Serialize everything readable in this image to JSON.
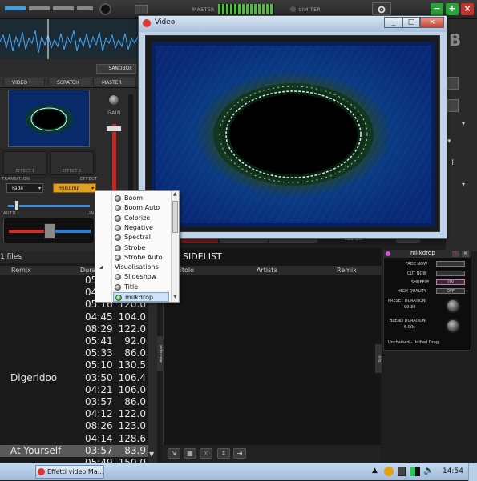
{
  "colors": {
    "accent_red": "#d62b2b",
    "accent_blue": "#2a7fd4",
    "preset_green": "#3cff40",
    "menu_select": "#cde4fb",
    "milkdrop_bg": "#0d0d0d"
  },
  "topbar": {
    "master_label": "MASTER",
    "limiter_label": "LIMITER",
    "gear_icon": "gear-icon",
    "minimize_label": "−",
    "maximize_label": "+",
    "close_label": "×"
  },
  "sandbox_label": "SANDBOX",
  "deck_tabs": {
    "video": "VIDEO",
    "scratch": "SCRATCH",
    "master": "MASTER"
  },
  "gain_label": "GAIN",
  "fx_slots": [
    "EFFECT 1",
    "EFFECT 2"
  ],
  "transition": {
    "label": "TRANSITION",
    "value": "Fade"
  },
  "effect": {
    "label": "EFFECT",
    "value": "milkdrop"
  },
  "crossfade": {
    "left": "AUTO",
    "right": "LIN"
  },
  "menu": {
    "items": [
      "Boom",
      "Boom Auto",
      "Colorize",
      "Negative",
      "Spectral",
      "Strobe",
      "Strobe Auto"
    ],
    "visualisations_header": "Visualisations",
    "vis_items": [
      "Slideshow",
      "Title",
      "milkdrop"
    ]
  },
  "video_window": {
    "title": "Video",
    "letter_behind": "B",
    "custom_label": "CUSTOM"
  },
  "browser": {
    "files_label": "1 files",
    "columns": {
      "remix": "Remix",
      "duration": "Dura"
    },
    "rows": [
      {
        "remix": "",
        "duration": "05:",
        "bpm": ""
      },
      {
        "remix": "",
        "duration": "04:",
        "bpm": ""
      },
      {
        "remix": "",
        "duration": "05:16",
        "bpm": "120.0"
      },
      {
        "remix": "",
        "duration": "04:45",
        "bpm": "104.0"
      },
      {
        "remix": "",
        "duration": "08:29",
        "bpm": "122.0"
      },
      {
        "remix": "",
        "duration": "05:41",
        "bpm": "92.0"
      },
      {
        "remix": "",
        "duration": "05:33",
        "bpm": "86.0"
      },
      {
        "remix": "",
        "duration": "05:10",
        "bpm": "130.5"
      },
      {
        "remix": "Digeridoo",
        "duration": "03:50",
        "bpm": "106.4"
      },
      {
        "remix": "",
        "duration": "04:21",
        "bpm": "106.0"
      },
      {
        "remix": "",
        "duration": "03:57",
        "bpm": "86.0"
      },
      {
        "remix": "",
        "duration": "04:12",
        "bpm": "122.0"
      },
      {
        "remix": "",
        "duration": "08:26",
        "bpm": "123.0"
      },
      {
        "remix": "",
        "duration": "04:14",
        "bpm": "128.6"
      },
      {
        "remix": "At Yourself",
        "duration": "03:57",
        "bpm": "83.9"
      },
      {
        "remix": "",
        "duration": "05:49",
        "bpm": "150.0"
      }
    ],
    "side_tab": "sideview"
  },
  "sidelist": {
    "title": "SIDELIST",
    "columns": {
      "titolo": "Titolo",
      "artista": "Artista",
      "remix": "Remix"
    },
    "info_tab": "info"
  },
  "milkdrop": {
    "title": "milkdrop",
    "fade_now": "FADE NOW",
    "cut_now": "CUT NOW",
    "shuffle": "SHUFFLE",
    "shuffle_value": "ON",
    "high_quality": "HIGH QUALITY",
    "high_quality_value": "OFF",
    "preset_duration_label": "PRESET DURATION",
    "preset_duration": "00:30",
    "blend_duration_label": "BLEND DURATION",
    "blend_duration": "5.00s",
    "preset_name": "Unchained - Unified Drag"
  },
  "taskbar": {
    "task_label": "Effetti video Ma...",
    "time": "14:54"
  }
}
